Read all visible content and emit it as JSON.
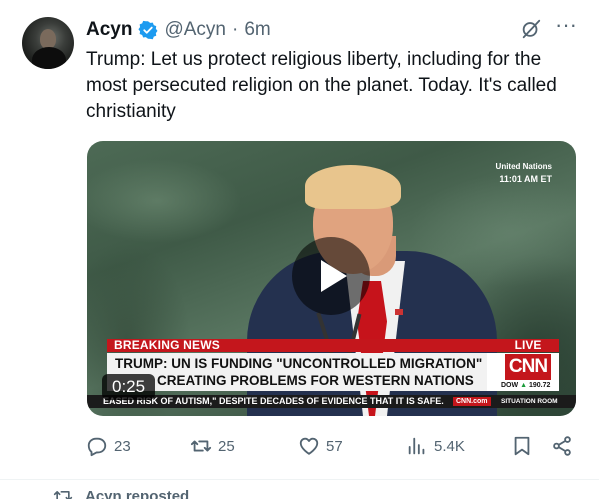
{
  "tweet": {
    "display_name": "Acyn",
    "handle": "@Acyn",
    "separator": "·",
    "time": "6m",
    "text": "Trump: Let us protect religious liberty, including for the most persecuted religion on the planet. Today. It's called christianity"
  },
  "media": {
    "corner_label": "United Nations",
    "corner_time": "11:01 AM ET",
    "breaking_label": "BREAKING NEWS",
    "live_label": "LIVE",
    "headline_line1": "TRUMP: UN IS FUNDING \"UNCONTROLLED MIGRATION\"",
    "headline_line2": "CREATING PROBLEMS FOR WESTERN NATIONS",
    "network_logo": "CNN",
    "dow_label": "DOW",
    "dow_arrow": "▲",
    "dow_value": "190.72",
    "ticker": "EASED RISK OF AUTISM,\" DESPITE DECADES OF EVIDENCE THAT IT IS SAFE.",
    "cnn_com": "CNN.com",
    "show_name": "SITUATION ROOM",
    "duration": "0:25"
  },
  "actions": {
    "replies": "23",
    "reposts": "25",
    "likes": "57",
    "views": "5.4K"
  },
  "next": {
    "reposted_label": "Acyn reposted"
  },
  "colors": {
    "verified": "#1d9bf0",
    "secondary_text": "#536471",
    "primary_text": "#0f1419",
    "cnn_red": "#c4161c"
  },
  "icons": [
    "verified-badge-icon",
    "grok-icon",
    "more-icon",
    "play-icon",
    "reply-icon",
    "repost-icon",
    "like-icon",
    "views-icon",
    "bookmark-icon",
    "share-icon"
  ]
}
